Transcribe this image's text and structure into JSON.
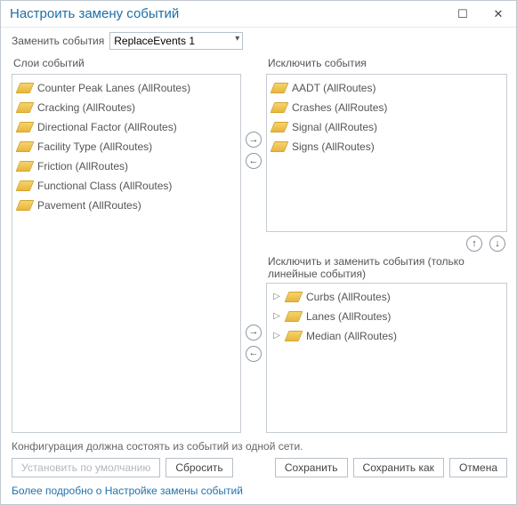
{
  "title": "Настроить замену событий",
  "toolbar": {
    "label": "Заменить события",
    "value": "ReplaceEvents 1"
  },
  "left_panel": {
    "label": "Слои событий",
    "items": [
      "Counter Peak Lanes (AllRoutes)",
      "Cracking (AllRoutes)",
      "Directional Factor (AllRoutes)",
      "Facility Type (AllRoutes)",
      "Friction (AllRoutes)",
      "Functional Class (AllRoutes)",
      "Pavement (AllRoutes)"
    ]
  },
  "right_top_panel": {
    "label": "Исключить события",
    "items": [
      "AADT (AllRoutes)",
      "Crashes (AllRoutes)",
      "Signal (AllRoutes)",
      "Signs (AllRoutes)"
    ]
  },
  "right_bottom_panel": {
    "label": "Исключить и заменить события (только линейные события)",
    "items": [
      "Curbs (AllRoutes)",
      "Lanes (AllRoutes)",
      "Median (AllRoutes)"
    ]
  },
  "footer_note": "Конфигурация должна состоять из событий из одной сети.",
  "buttons": {
    "set_default": "Установить по умолчанию",
    "reset": "Сбросить",
    "save": "Сохранить",
    "save_as": "Сохранить как",
    "cancel": "Отмена"
  },
  "link": "Более подробно о Настройке замены событий"
}
